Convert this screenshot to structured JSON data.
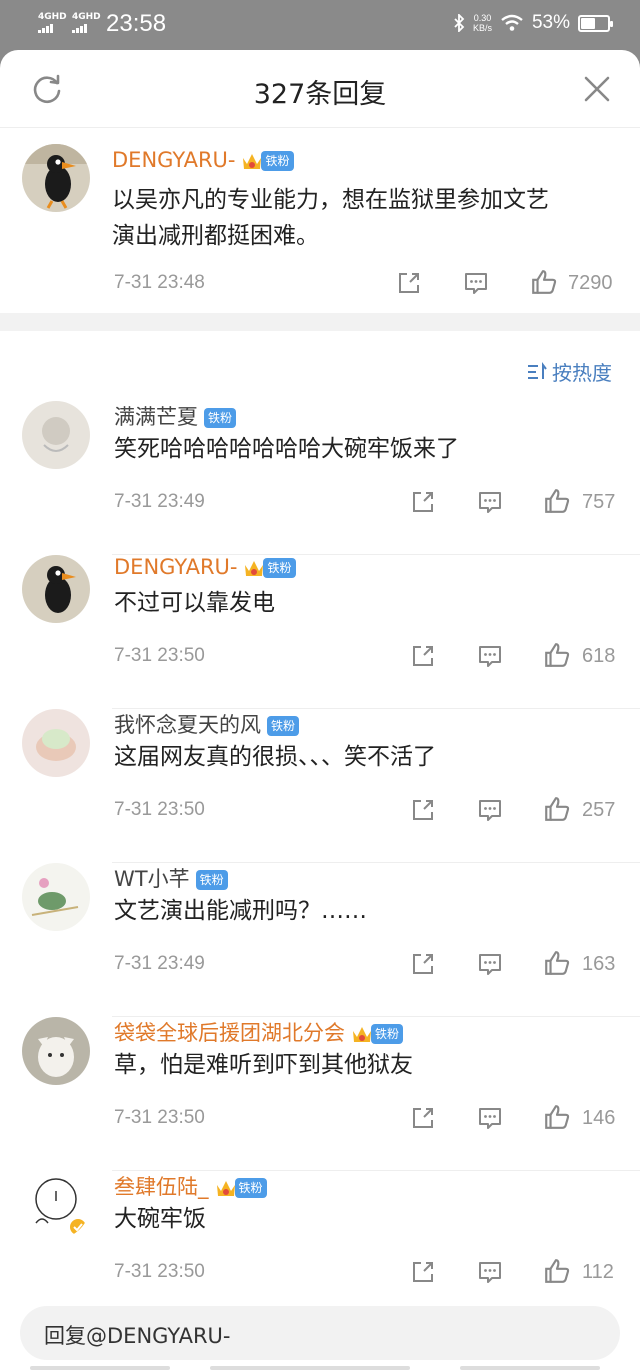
{
  "status_bar": {
    "network1": "4GHD",
    "network2": "4GHD",
    "time": "23:58",
    "speed_value": "0.30",
    "speed_unit": "KB/s",
    "battery": "53%",
    "battery_level": 0.53
  },
  "header": {
    "title": "327条回复"
  },
  "main_comment": {
    "username": "DENGYARU-",
    "badge": "铁粉",
    "text_line1": "以吴亦凡的专业能力，想在监狱里参加文艺",
    "text_line2": "演出减刑都挺困难。",
    "time": "7-31 23:48",
    "likes": "7290"
  },
  "sort": {
    "label": "按热度",
    "icon": "sort-icon"
  },
  "replies": [
    {
      "username": "满满芒夏",
      "badge": "铁粉",
      "text": "笑死哈哈哈哈哈哈哈大碗牢饭来了",
      "time": "7-31 23:49",
      "likes": "757",
      "name_color": "#444444",
      "crown": false
    },
    {
      "username": "DENGYARU-",
      "badge": "铁粉",
      "text": "不过可以靠发电",
      "time": "7-31 23:50",
      "likes": "618",
      "name_color": "#e0792a",
      "crown": true
    },
    {
      "username": "我怀念夏天的风",
      "badge": "铁粉",
      "text": "这届网友真的很损、、、笑不活了",
      "time": "7-31 23:50",
      "likes": "257",
      "name_color": "#444444",
      "crown": false
    },
    {
      "username": "WT小芊",
      "badge": "铁粉",
      "text": "文艺演出能减刑吗？……",
      "time": "7-31 23:49",
      "likes": "163",
      "name_color": "#444444",
      "crown": false
    },
    {
      "username": "袋袋全球后援团湖北分会",
      "badge": "铁粉",
      "text": "草，怕是难听到吓到其他狱友",
      "time": "7-31 23:50",
      "likes": "146",
      "name_color": "#e0792a",
      "crown": true
    },
    {
      "username": "叁肆伍陆_",
      "badge": "铁粉",
      "text": "大碗牢饭",
      "time": "7-31 23:50",
      "likes": "112",
      "name_color": "#e0792a",
      "crown": true
    }
  ],
  "input": {
    "placeholder": "回复@DENGYARU-"
  },
  "colors": {
    "accent_orange": "#e0792a",
    "badge_blue": "#4d9ce8",
    "link_blue": "#4a7fbf",
    "secondary_gray": "#999999"
  }
}
